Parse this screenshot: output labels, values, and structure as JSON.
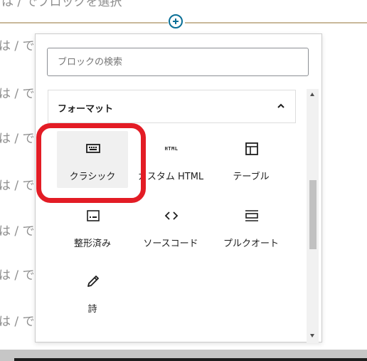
{
  "background": {
    "top_text": "は / でブロックを選択",
    "line_text": "は / で",
    "inserter_accent": "#0a6f96",
    "separator_color": "#c9b99a"
  },
  "inserter": {
    "search": {
      "placeholder": "ブロックの検索",
      "value": ""
    },
    "panel": {
      "title": "フォーマット",
      "icon": "chevron-up-icon"
    },
    "blocks": [
      {
        "label": "クラシック",
        "icon": "keyboard-icon",
        "selected": true
      },
      {
        "label": "カスタム HTML",
        "icon": "html-icon",
        "icon_text": "HTML"
      },
      {
        "label": "テーブル",
        "icon": "table-icon"
      },
      {
        "label": "整形済み",
        "icon": "preformatted-icon"
      },
      {
        "label": "ソースコード",
        "icon": "code-icon"
      },
      {
        "label": "プルクオート",
        "icon": "pullquote-icon"
      },
      {
        "label": "詩",
        "icon": "pencil-icon"
      }
    ]
  },
  "annotation": {
    "highlight_color": "#e31c25"
  }
}
